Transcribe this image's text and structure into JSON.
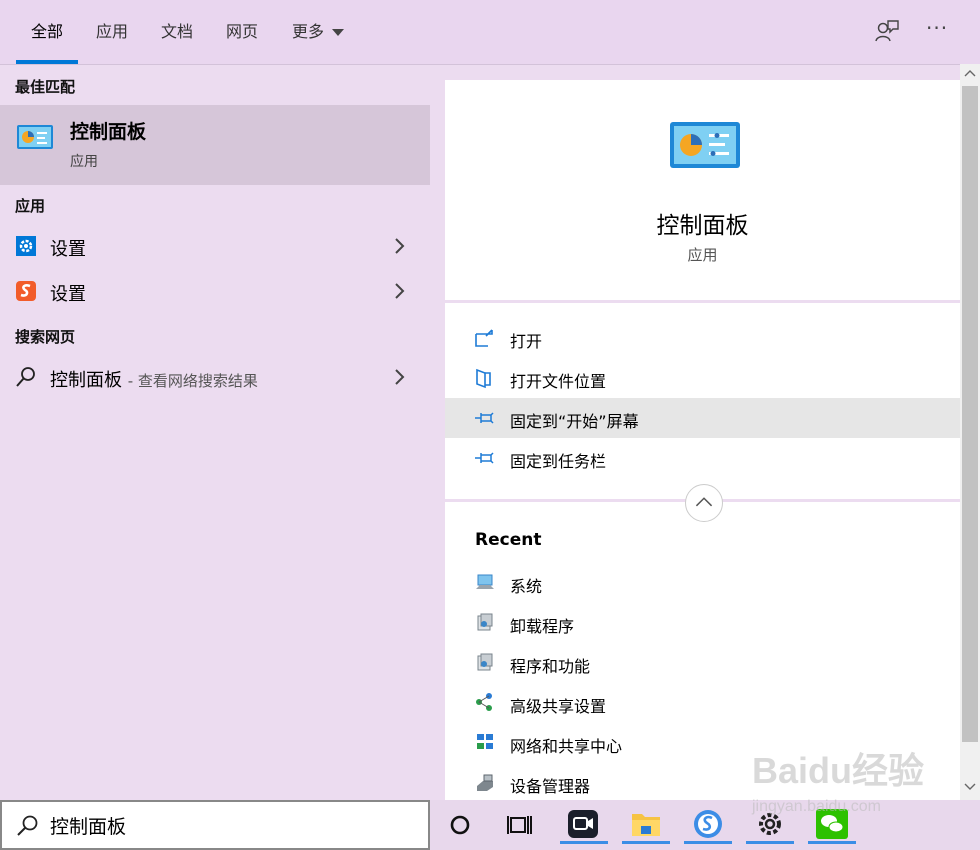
{
  "tabs": [
    {
      "label": "全部",
      "active": true
    },
    {
      "label": "应用"
    },
    {
      "label": "文档"
    },
    {
      "label": "网页"
    },
    {
      "label": "更多"
    }
  ],
  "left": {
    "best_match_label": "最佳匹配",
    "best_match": {
      "title": "控制面板",
      "subtitle": "应用",
      "icon": "control-panel-icon"
    },
    "apps_label": "应用",
    "apps": [
      {
        "label": "设置",
        "icon": "settings-gear-icon"
      },
      {
        "label": "设置",
        "icon": "sogou-settings-icon"
      }
    ],
    "web_label": "搜索网页",
    "web_item": {
      "label": "控制面板",
      "hint": "- 查看网络搜索结果",
      "icon": "search-icon"
    }
  },
  "search": {
    "value": "控制面板"
  },
  "right": {
    "title": "控制面板",
    "subtitle": "应用",
    "actions": [
      {
        "label": "打开",
        "icon": "open-icon"
      },
      {
        "label": "打开文件位置",
        "icon": "file-location-icon"
      },
      {
        "label": "固定到“开始”屏幕",
        "icon": "pin-icon",
        "highlighted": true
      },
      {
        "label": "固定到任务栏",
        "icon": "pin-icon"
      }
    ],
    "recent_label": "Recent",
    "recent": [
      {
        "label": "系统",
        "icon": "system-icon"
      },
      {
        "label": "卸载程序",
        "icon": "programs-icon"
      },
      {
        "label": "程序和功能",
        "icon": "programs-icon"
      },
      {
        "label": "高级共享设置",
        "icon": "network-share-icon"
      },
      {
        "label": "网络和共享中心",
        "icon": "network-center-icon"
      },
      {
        "label": "设备管理器",
        "icon": "device-manager-icon"
      }
    ]
  },
  "watermark": {
    "line1": "Baidu经验",
    "line2": "jingyan.baidu.com"
  },
  "colors": {
    "accent": "#0078d7",
    "panel_bg": "#ecdcf0",
    "selected_bg": "#d6c6d9",
    "hover_bg": "#e6e6e6"
  }
}
